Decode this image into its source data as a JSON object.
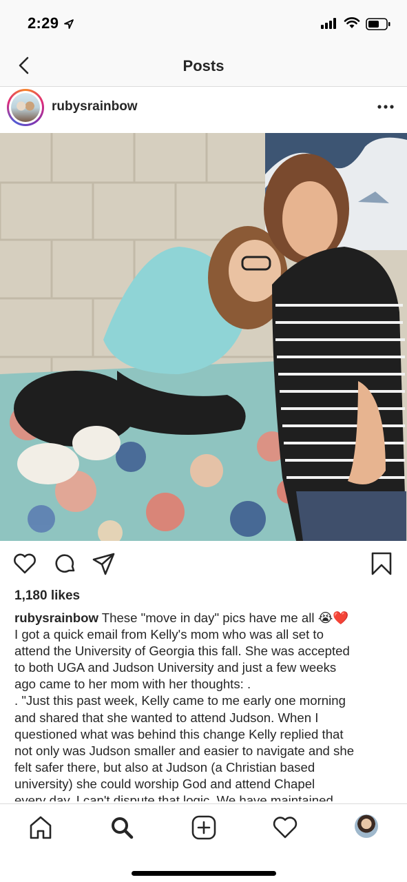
{
  "status_bar": {
    "time": "2:29",
    "icons": [
      "location-arrow-icon",
      "signal-icon",
      "wifi-icon",
      "battery-icon"
    ]
  },
  "nav": {
    "title": "Posts",
    "back_icon": "chevron-left-icon"
  },
  "post": {
    "username": "rubysrainbow",
    "more_icon": "ellipsis-icon",
    "photo_icon": "photo",
    "likes": "1,180 likes",
    "actions": [
      "heart-icon",
      "comment-icon",
      "share-icon",
      "bookmark-icon"
    ],
    "caption": {
      "username": "rubysrainbow",
      "first_line_text": " These \"move in day\" pics have me all 😭❤️",
      "lines": [
        "I got a quick email from Kelly's mom who was all set to",
        "attend the University of Georgia this fall. She was accepted",
        "to both UGA and Judson University and just a few weeks",
        "ago came to her mom with her thoughts: .",
        ". \"Just this past week, Kelly came to me early one morning",
        "and shared that she wanted to attend Judson.  When I",
        "questioned what was behind this change Kelly replied that",
        "not only was Judson smaller and easier to navigate and she",
        "felt safer there, but also at Judson (a Christian based",
        "university)  she could worship God and attend Chapel",
        "every day.  I can't dispute that logic.  We have maintained"
      ]
    }
  },
  "tab_bar": {
    "tabs": [
      "home-icon",
      "search-icon",
      "add-post-icon",
      "activity-heart-icon",
      "profile-avatar"
    ]
  },
  "colors": {
    "text": "#262626",
    "divider": "#dbdbdb",
    "bar_bg": "#f9f9f9"
  }
}
